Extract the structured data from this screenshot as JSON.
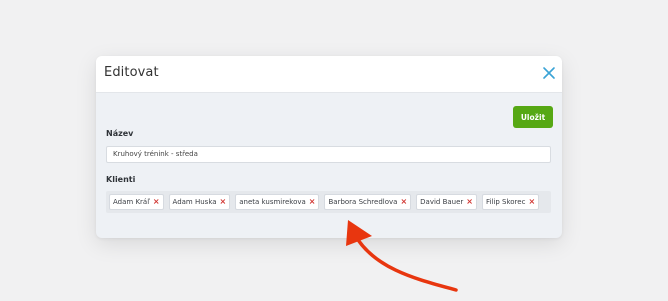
{
  "modal": {
    "title": "Editovat",
    "save_label": "Uložit",
    "name_label": "Název",
    "name_value": "Kruhový trénink - středa",
    "clients_label": "Klienti",
    "clients": [
      "Adam Kráľ",
      "Adam Huska",
      "aneta kusmirekova",
      "Barbora Schredlova",
      "David Bauer",
      "Filip Skorec"
    ],
    "remove_symbol": "×"
  },
  "colors": {
    "save_green": "#56a814",
    "close_blue": "#3aa3d6",
    "remove_red": "#d0312d",
    "annotation_arrow": "#e8360f"
  }
}
